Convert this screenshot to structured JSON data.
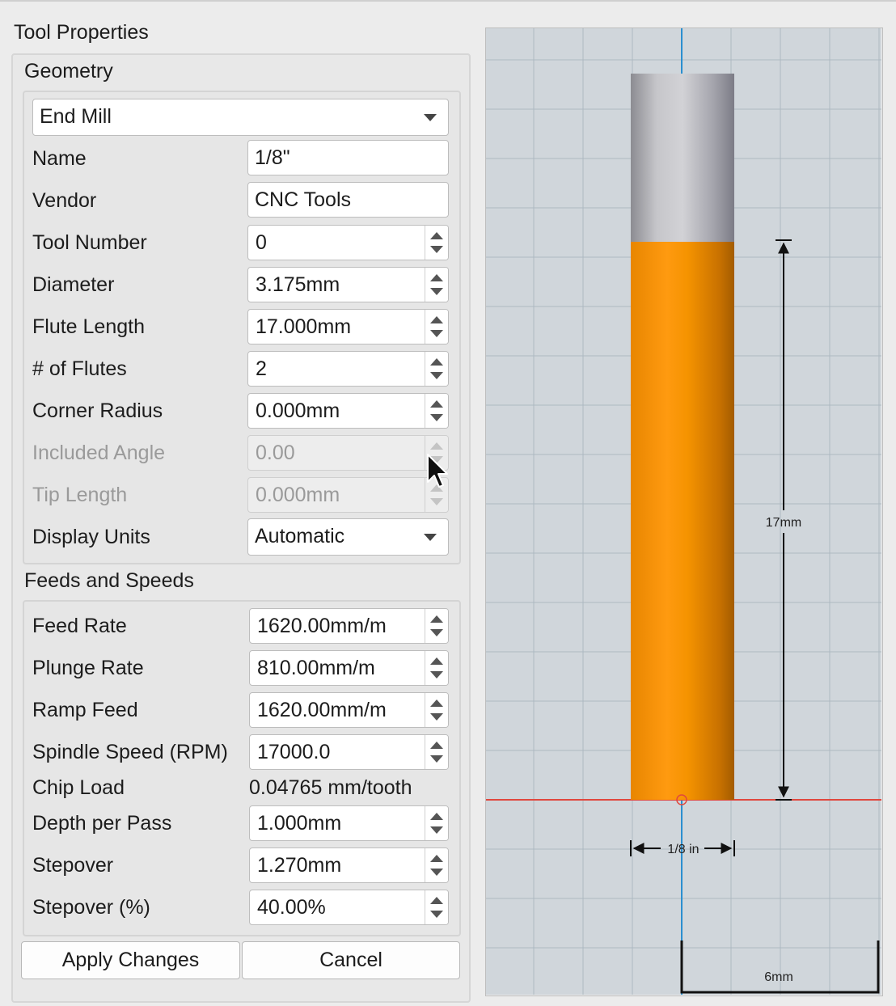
{
  "panel": {
    "title": "Tool Properties"
  },
  "geometry": {
    "title": "Geometry",
    "tool_type": "End Mill",
    "fields": {
      "name": {
        "label": "Name",
        "value": "1/8\""
      },
      "vendor": {
        "label": "Vendor",
        "value": "CNC Tools"
      },
      "tool_number": {
        "label": "Tool Number",
        "value": "0"
      },
      "diameter": {
        "label": "Diameter",
        "value": "3.175mm"
      },
      "flute_length": {
        "label": "Flute Length",
        "value": "17.000mm"
      },
      "flutes": {
        "label": "# of Flutes",
        "value": "2"
      },
      "corner_radius": {
        "label": "Corner Radius",
        "value": "0.000mm"
      },
      "included_angle": {
        "label": "Included Angle",
        "value": "0.00"
      },
      "tip_length": {
        "label": "Tip Length",
        "value": "0.000mm"
      },
      "display_units": {
        "label": "Display Units",
        "value": "Automatic"
      }
    }
  },
  "feeds": {
    "title": "Feeds and Speeds",
    "fields": {
      "feed_rate": {
        "label": "Feed Rate",
        "value": "1620.00mm/m"
      },
      "plunge_rate": {
        "label": "Plunge Rate",
        "value": "810.00mm/m"
      },
      "ramp_feed": {
        "label": "Ramp Feed",
        "value": "1620.00mm/m"
      },
      "spindle_speed": {
        "label": "Spindle Speed (RPM)",
        "value": "17000.0"
      },
      "chip_load": {
        "label": "Chip Load",
        "value": "0.04765 mm/tooth"
      },
      "depth_per_pass": {
        "label": "Depth per Pass",
        "value": "1.000mm"
      },
      "stepover": {
        "label": "Stepover",
        "value": "1.270mm"
      },
      "stepover_pct": {
        "label": "Stepover (%)",
        "value": "40.00%"
      }
    }
  },
  "buttons": {
    "apply": "Apply Changes",
    "cancel": "Cancel"
  },
  "preview": {
    "flute_dimension": "17mm",
    "diameter_dimension": "1/8 in",
    "scale_dimension": "6mm",
    "colors": {
      "flute": "#f39200",
      "shank": "#c8c8cc",
      "grid_bg": "#d0d6db",
      "grid_line": "#aeb9c2",
      "center_axis": "#2a8fd0",
      "baseline": "#e0483e"
    }
  }
}
